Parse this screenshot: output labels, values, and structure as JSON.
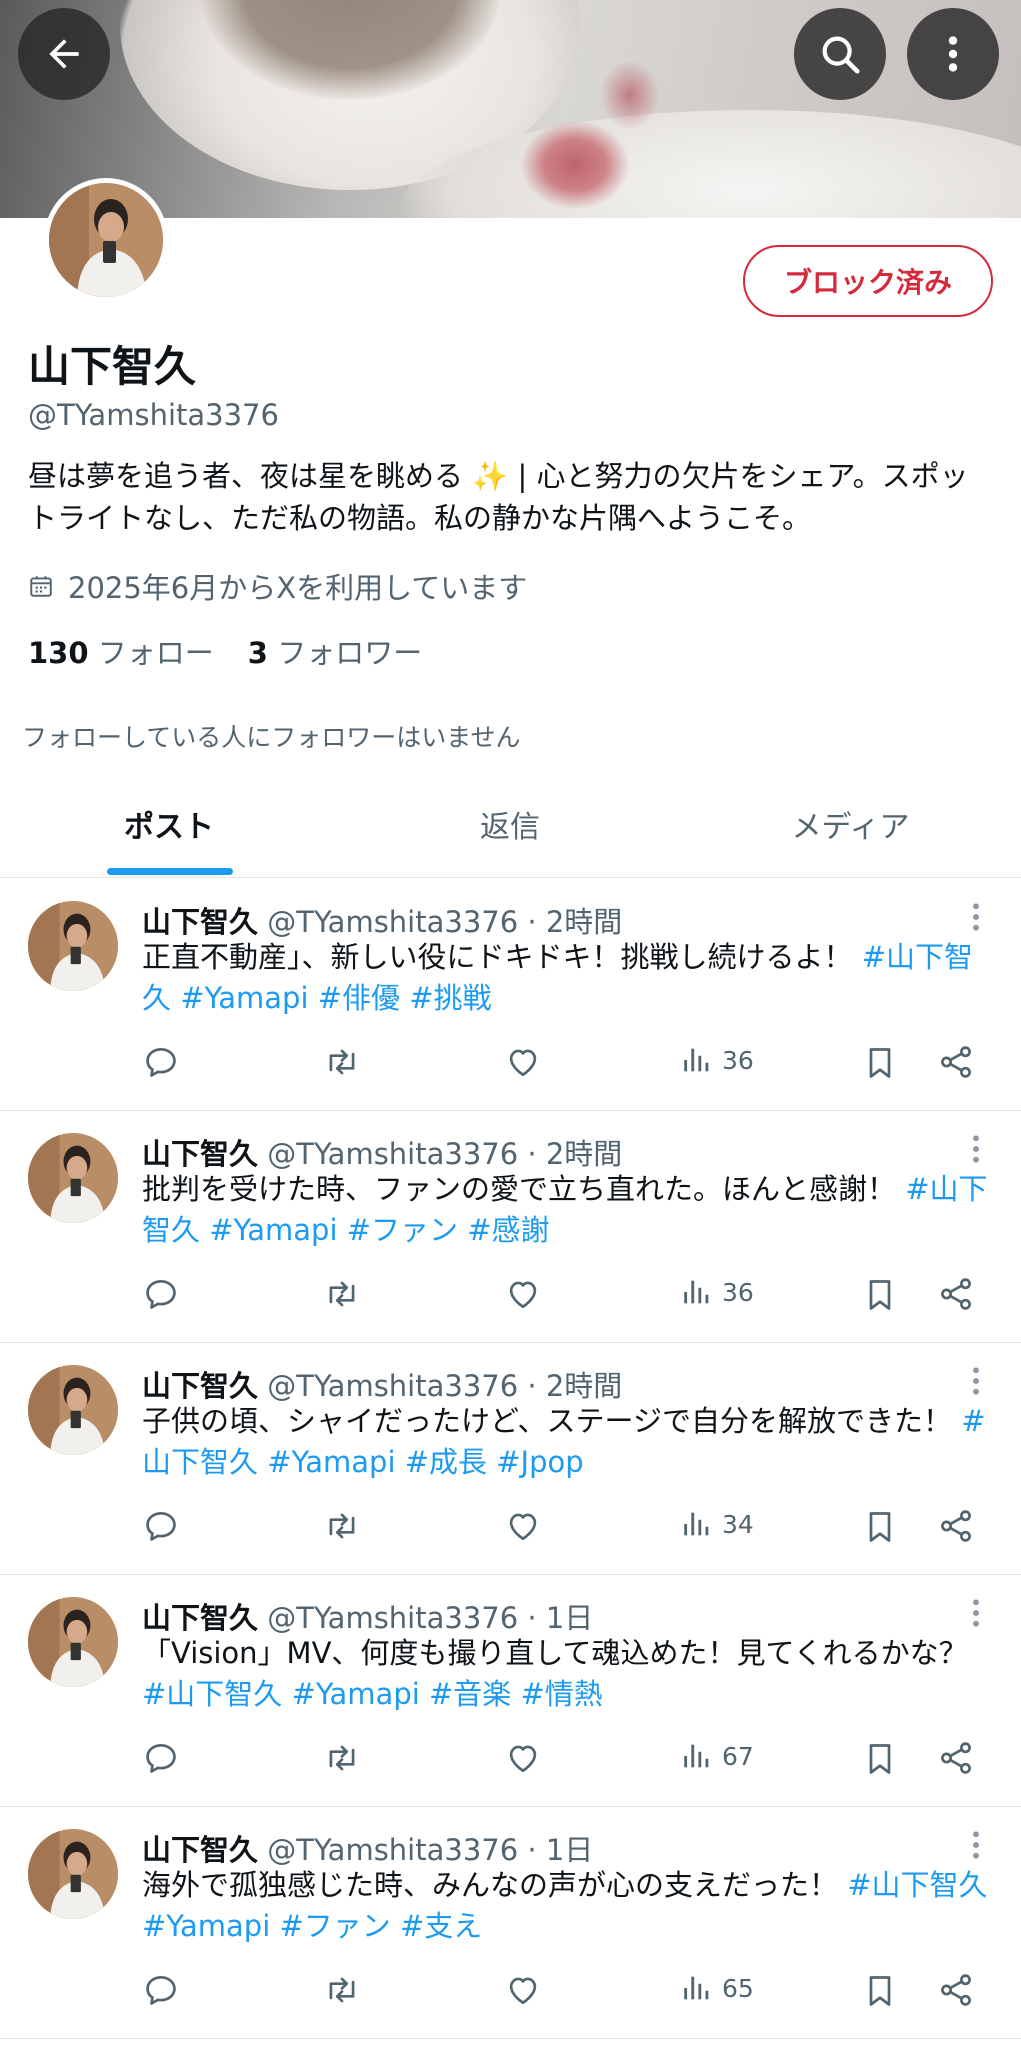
{
  "header": {
    "back_icon": "arrow-left-icon",
    "search_icon": "search-icon",
    "more_icon": "more-vertical-icon"
  },
  "profile": {
    "name": "山下智久",
    "handle": "@TYamshita3376",
    "bio": "昼は夢を追う者、夜は星を眺める ✨ | 心と努力の欠片をシェア。スポットライトなし、ただ私の物語。私の静かな片隅へようこそ。",
    "joined": "2025年6月からXを利用しています",
    "following_count": "130",
    "following_label": "フォロー",
    "followers_count": "3",
    "followers_label": "フォロワー",
    "mutual_note": "フォローしている人にフォロワーはいません",
    "block_button": "ブロック済み"
  },
  "tabs": [
    {
      "label": "ポスト",
      "active": true
    },
    {
      "label": "返信",
      "active": false
    },
    {
      "label": "メディア",
      "active": false
    }
  ],
  "posts": [
    {
      "name": "山下智久",
      "sub": "@TYamshita3376 · 2時間",
      "text": "正直不動産」、新しい役にドキドキ！挑戦し続けるよ！",
      "tags": " #山下智久 #Yamapi #俳優 #挑戦",
      "views": "36"
    },
    {
      "name": "山下智久",
      "sub": "@TYamshita3376 · 2時間",
      "text": "批判を受けた時、ファンの愛で立ち直れた。ほんと感謝！",
      "tags": " #山下智久 #Yamapi #ファン #感謝",
      "views": "36"
    },
    {
      "name": "山下智久",
      "sub": "@TYamshita3376 · 2時間",
      "text": "子供の頃、シャイだったけど、ステージで自分を解放できた！",
      "tags": " #山下智久 #Yamapi #成長 #Jpop",
      "views": "34"
    },
    {
      "name": "山下智久",
      "sub": "@TYamshita3376 · 1日",
      "text": "「Vision」MV、何度も撮り直して魂込めた！見てくれるかな？",
      "tags": " #山下智久 #Yamapi #音楽 #情熱",
      "views": "67"
    },
    {
      "name": "山下智久",
      "sub": "@TYamshita3376 · 1日",
      "text": "海外で孤独感じた時、みんなの声が心の支えだった！",
      "tags": " #山下智久 #Yamapi #ファン #支え",
      "views": "65"
    }
  ],
  "colors": {
    "accent": "#1d9bf0",
    "block_red": "#d6293c",
    "secondary_text": "#536471"
  }
}
